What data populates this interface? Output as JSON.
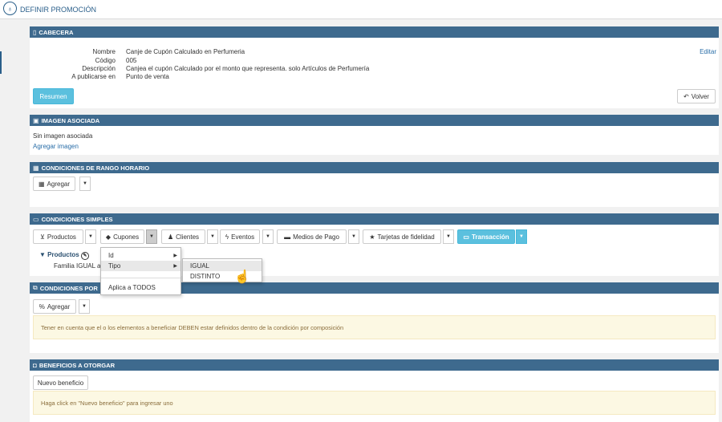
{
  "header": {
    "title": "DEFINIR PROMOCIÓN"
  },
  "cabecera": {
    "title": "CABECERA",
    "edit_link": "Editar",
    "fields": [
      {
        "label": "Nombre",
        "value": "Canje de Cupón Calculado en Perfumeria"
      },
      {
        "label": "Código",
        "value": "005"
      },
      {
        "label": "Descripción",
        "value": "Canjea el cupón Calculado por el monto que representa. solo Artículos de Perfumería"
      },
      {
        "label": "A publicarse en",
        "value": "Punto de venta"
      }
    ],
    "summary_button": "Resumen",
    "back_button": "Volver"
  },
  "imagen": {
    "title": "IMAGEN ASOCIADA",
    "status": "Sin imagen asociada",
    "add_link": "Agregar imagen"
  },
  "rango": {
    "title": "CONDICIONES DE RANGO HORARIO",
    "add_button": "Agregar"
  },
  "simples": {
    "title": "CONDICIONES SIMPLES",
    "buttons": [
      "Productos",
      "Cupones",
      "Clientes",
      "Eventos",
      "Medios de Pago",
      "Tarjetas de fidelidad",
      "Transacción"
    ],
    "tree_root": "Productos",
    "tree_item": "Familia IGUAL a I"
  },
  "dropdown": {
    "items": [
      "Id",
      "Tipo",
      "Aplica a TODOS"
    ],
    "submenu": [
      "IGUAL",
      "DISTINTO"
    ]
  },
  "composicion": {
    "title": "CONDICIONES POR",
    "add_button": "Agregar",
    "alert": "Tener en cuenta que el o los elementos a beneficiar DEBEN estar definidos dentro de la condición por composición"
  },
  "beneficios": {
    "title": "BENEFICIOS A OTORGAR",
    "new_button": "Nuevo beneficio",
    "alert": "Haga click en \"Nuevo beneficio\" para ingresar uno"
  },
  "colors": {
    "header": "#3e6a8e",
    "primary": "#5bc0de",
    "alert_bg": "#fcf8e3",
    "alert_text": "#8a6d3b"
  }
}
